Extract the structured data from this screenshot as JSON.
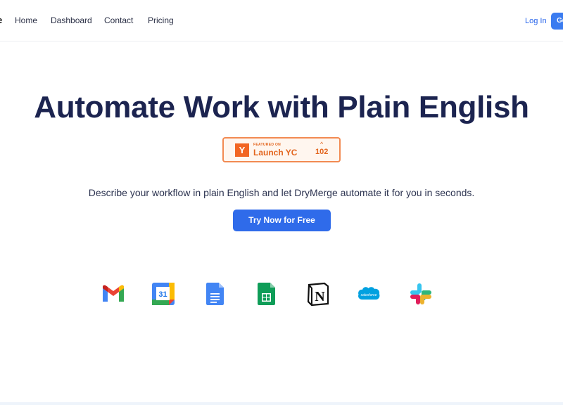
{
  "nav": {
    "brand_fragment": "e",
    "links": [
      "Home",
      "Dashboard",
      "Contact",
      "Pricing"
    ],
    "login": "Log In",
    "cta_partial": "Ge"
  },
  "hero": {
    "title": "Automate Work with Plain English",
    "subtitle": "Describe your workflow in plain English and let DryMerge automate it for you in seconds.",
    "cta": "Try Now for Free"
  },
  "badge": {
    "featured": "FEATURED ON",
    "name": "Launch YC",
    "logo_letter": "Y",
    "upvote_icon": "caret-up-icon",
    "upvotes": "102"
  },
  "integrations": {
    "icons": [
      "gmail-icon",
      "google-calendar-icon",
      "google-docs-icon",
      "google-sheets-icon",
      "notion-icon",
      "salesforce-icon",
      "slack-icon"
    ],
    "calendar_day": "31",
    "salesforce_wordmark": "salesforce",
    "notion_letter": "N"
  },
  "colors": {
    "primary": "#2f6bea",
    "title": "#1c2450",
    "yc_orange": "#f26522"
  }
}
